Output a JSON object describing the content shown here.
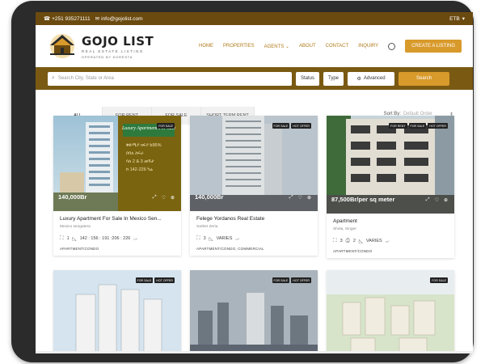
{
  "topbar": {
    "phone": "+251 935271111",
    "email": "info@gojolist.com",
    "currency": "ETB"
  },
  "brand": {
    "title": "GOJO LIST",
    "subtitle": "REAL ESTATE LISTING",
    "operator": "OPERATED BY KORESTA"
  },
  "nav": {
    "items": [
      "HOME",
      "PROPERTIES",
      "AGENTS",
      "ABOUT",
      "CONTACT",
      "INQUIRY"
    ],
    "cta": "CREATE A LISTING"
  },
  "search": {
    "placeholder": "Search City, State or Area",
    "status_label": "Status",
    "type_label": "Type",
    "advanced_label": "Advanced",
    "search_label": "Search"
  },
  "tabs": [
    "ALL",
    "FOR RENT",
    "FOR SALE",
    "SHORT TERM RENT"
  ],
  "sort": {
    "label": "Sort By:",
    "value": "Default Order"
  },
  "listings": [
    {
      "price": "140,000Br",
      "badges": [
        "FOR SALE"
      ],
      "title": "Luxury Apartment For Sale In Mexico Sen...",
      "location": "Mexico sengatera",
      "beds": "1",
      "area": "142 : 156 : 191 :206 : 226",
      "area_unit": "m²",
      "type": "APARTMENT/CONDO",
      "overlay_title": "Luxury Apartment For Sale",
      "overlay_lines": [
        "ቅድሚያ ክፍያ b95%",
        "በባለ ስፍራ",
        "ባለ 2 & 3 መኝታ",
        "ከ 142-226 ካሬ"
      ]
    },
    {
      "price": "140,000Br",
      "badges": [
        "FOR SALE",
        "HOT OFFER"
      ],
      "title": "Felege Yordanos Real Estate",
      "location": "Sarbet Zeria",
      "beds": "3",
      "area": "VARIES",
      "area_unit": "m²",
      "type": "APARTMENT/CONDO, COMMERCIAL"
    },
    {
      "price": "87,500Br/per sq meter",
      "badges": [
        "FOR RENT",
        "FOR SALE",
        "HOT OFFER"
      ],
      "title": "Apartment",
      "location": "Shola, Singer",
      "beds": "3",
      "baths": "2",
      "area": "VARIES",
      "area_unit": "m²",
      "type": "APARTMENT/CONDO"
    },
    {
      "badges": [
        "FOR SALE",
        "HOT OFFER"
      ]
    },
    {
      "badges": [
        "FOR SALE",
        "HOT OFFER"
      ]
    },
    {
      "badges": [
        "FOR SALE"
      ]
    }
  ],
  "colors": {
    "topbar": "#6b4a0f",
    "searchbar": "#7a5a12",
    "accent": "#d89a2b",
    "nav_text": "#b07a1a"
  }
}
